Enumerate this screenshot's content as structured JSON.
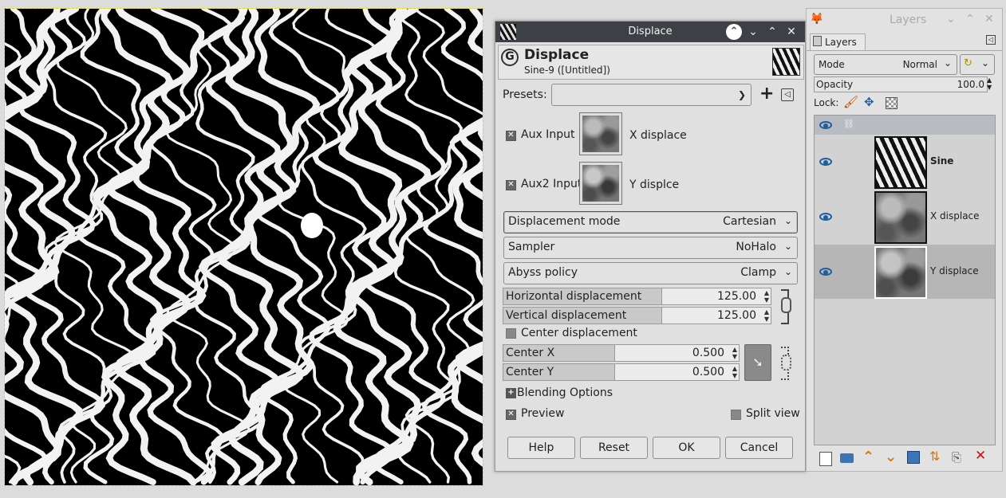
{
  "dialog": {
    "window_title": "Displace",
    "header_title": "Displace",
    "header_subtitle": "Sine-9 ([Untitled])",
    "presets_label": "Presets:",
    "aux_input_label": "Aux Input",
    "aux_input_layer": "X displace",
    "aux2_input_label": "Aux2 Input",
    "aux2_input_layer": "Y displce",
    "displacement_mode": {
      "label": "Displacement mode",
      "value": "Cartesian"
    },
    "sampler": {
      "label": "Sampler",
      "value": "NoHalo"
    },
    "abyss_policy": {
      "label": "Abyss policy",
      "value": "Clamp"
    },
    "horizontal_displacement": {
      "label": "Horizontal displacement",
      "value": "125.00"
    },
    "vertical_displacement": {
      "label": "Vertical displacement",
      "value": "125.00"
    },
    "center_displacement_label": "Center displacement",
    "center_x": {
      "label": "Center X",
      "value": "0.500"
    },
    "center_y": {
      "label": "Center Y",
      "value": "0.500"
    },
    "blending_options_label": "Blending Options",
    "preview_label": "Preview",
    "split_view_label": "Split view",
    "buttons": {
      "help": "Help",
      "reset": "Reset",
      "ok": "OK",
      "cancel": "Cancel"
    }
  },
  "layers_dock": {
    "window_title": "Layers",
    "tab_label": "Layers",
    "mode_label": "Mode",
    "mode_value": "Normal",
    "opacity_label": "Opacity",
    "opacity_value": "100.0",
    "lock_label": "Lock:",
    "layers": [
      {
        "name": "Sine",
        "bold": true
      },
      {
        "name": "X displace",
        "bold": false
      },
      {
        "name": "Y displace",
        "bold": false
      }
    ]
  },
  "colors": {
    "titlebar": "#3d4145",
    "accent_blue": "#1d5f9e",
    "selection_dash": "#e8d800"
  }
}
